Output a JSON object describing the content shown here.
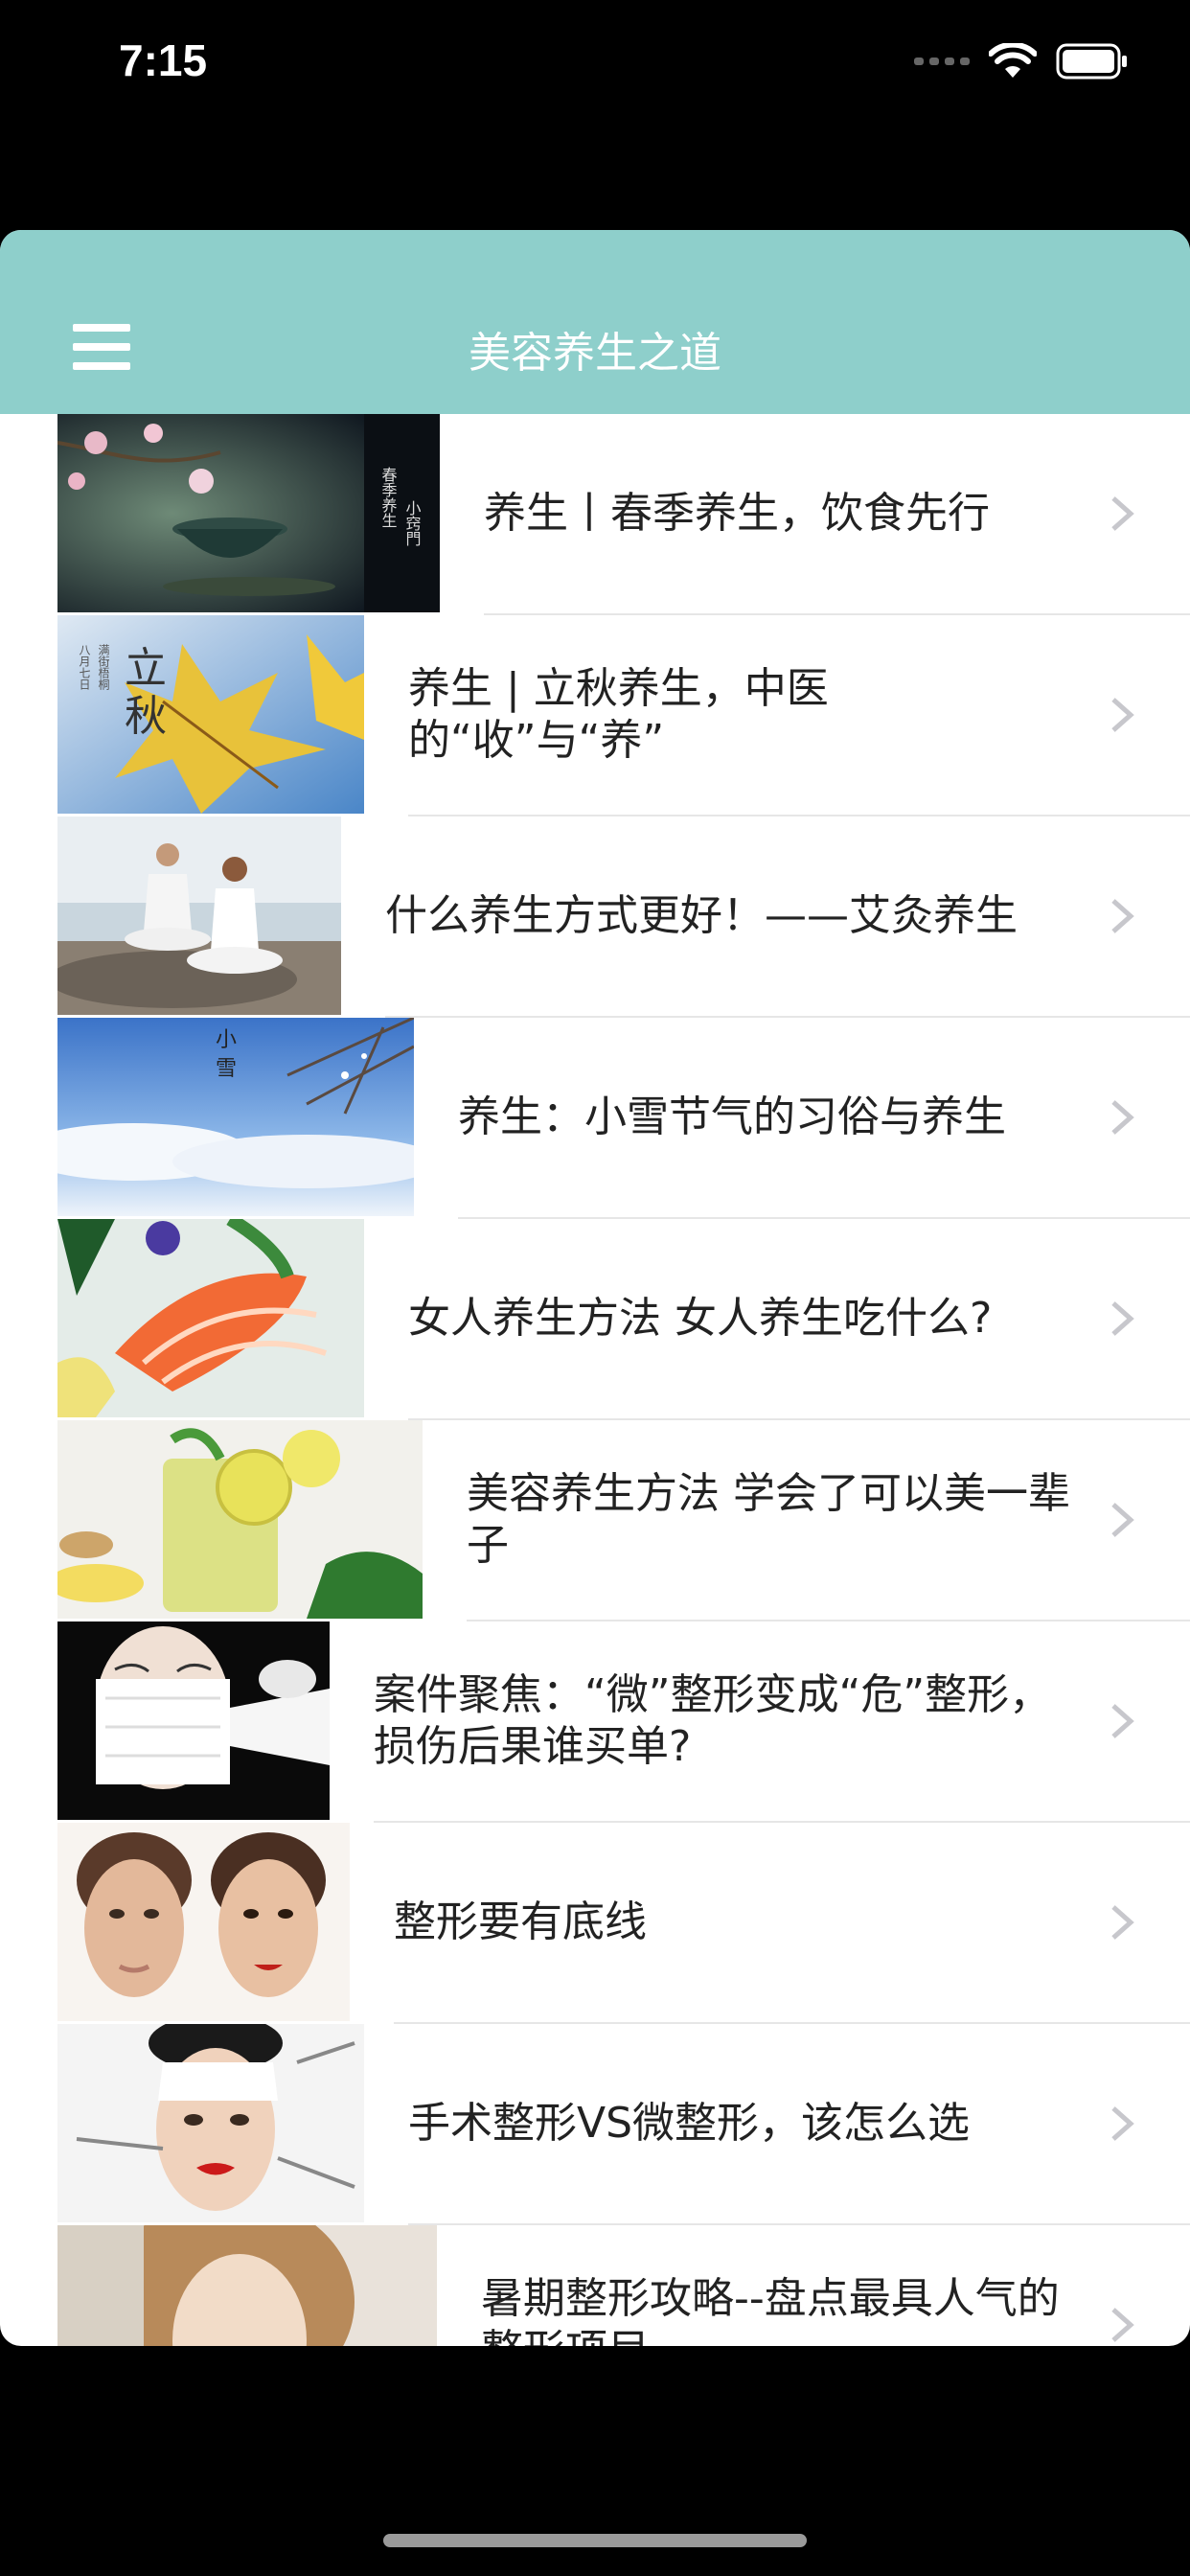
{
  "status_bar": {
    "time": "7:15"
  },
  "navbar": {
    "title": "美容养生之道",
    "menu_icon": "hamburger-menu-icon"
  },
  "articles": [
    {
      "title": "养生丨春季养生，饮食先行",
      "thumb_name": "spring-tea-thumbnail",
      "thumb_text": "春季养生小窍門",
      "chevron_icon": "chevron-right-icon"
    },
    {
      "title": "养生 | 立秋养生，中医的“收”与“养”",
      "thumb_name": "autumn-leaf-thumbnail",
      "thumb_text": "立秋",
      "chevron_icon": "chevron-right-icon"
    },
    {
      "title": "什么养生方式更好！——艾灸养生",
      "thumb_name": "meditation-beach-thumbnail",
      "chevron_icon": "chevron-right-icon"
    },
    {
      "title": "养生：小雪节气的习俗与养生",
      "thumb_name": "snow-branch-thumbnail",
      "thumb_text": "小雪",
      "chevron_icon": "chevron-right-icon"
    },
    {
      "title": "女人养生方法 女人养生吃什么?",
      "thumb_name": "salmon-sashimi-thumbnail",
      "chevron_icon": "chevron-right-icon"
    },
    {
      "title": "美容养生方法 学会了可以美一辈子",
      "thumb_name": "lemon-drink-thumbnail",
      "chevron_icon": "chevron-right-icon"
    },
    {
      "title": "案件聚焦：“微”整形变成“危”整形，损伤后果谁买单?",
      "thumb_name": "bandaged-face-thumbnail",
      "chevron_icon": "chevron-right-icon"
    },
    {
      "title": "整形要有底线",
      "thumb_name": "two-faces-thumbnail",
      "chevron_icon": "chevron-right-icon"
    },
    {
      "title": "手术整形VS微整形，该怎么选",
      "thumb_name": "injection-face-thumbnail",
      "chevron_icon": "chevron-right-icon"
    },
    {
      "title": "暑期整形攻略--盘点最具人气的整形项目",
      "thumb_name": "woman-portrait-thumbnail",
      "chevron_icon": "chevron-right-icon"
    }
  ],
  "colors": {
    "navbar": "#8ecfcb",
    "background": "#000000",
    "list_bg": "#ffffff",
    "separator": "#e6e6e6",
    "chevron": "#c7c7cc"
  }
}
